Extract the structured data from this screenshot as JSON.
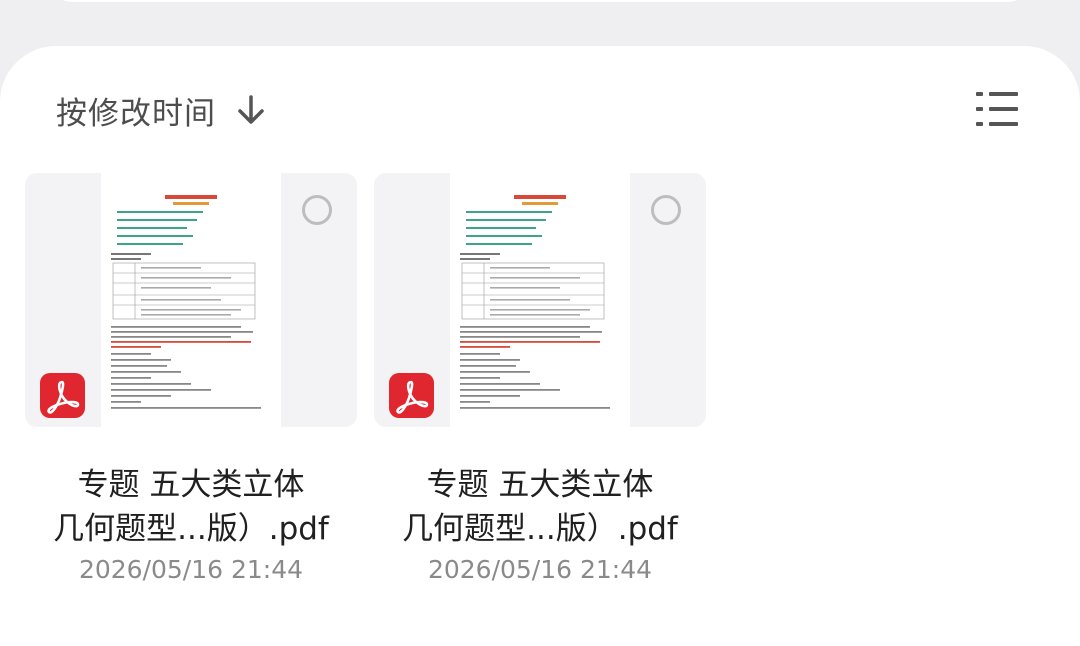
{
  "toolbar": {
    "sort_label": "按修改时间",
    "sort_direction_icon": "arrow-down-icon",
    "view_toggle_icon": "list-view-icon"
  },
  "files": [
    {
      "name_line1": "专题  五大类立体",
      "name_line2": "几何题型...版）.pdf",
      "date": "2026/05/16 21:44",
      "type_icon": "pdf-icon",
      "selected": false
    },
    {
      "name_line1": "专题  五大类立体",
      "name_line2": "几何题型...版）.pdf",
      "date": "2026/05/16 21:44",
      "type_icon": "pdf-icon",
      "selected": false
    }
  ],
  "colors": {
    "pdf_badge": "#e0262f",
    "background": "#efeff1",
    "sheet": "#ffffff",
    "date_text": "#8a8a8a"
  }
}
